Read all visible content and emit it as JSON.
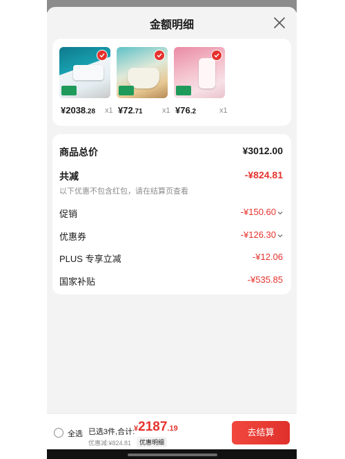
{
  "sheet": {
    "title": "金额明细"
  },
  "products": [
    {
      "price_int": "¥2038",
      "price_dec": ".28",
      "qty": "x1"
    },
    {
      "price_int": "¥72",
      "price_dec": ".71",
      "qty": "x1"
    },
    {
      "price_int": "¥76",
      "price_dec": ".2",
      "qty": "x1"
    }
  ],
  "summary": {
    "goods_total_label": "商品总价",
    "goods_total_value": "¥3012.00",
    "total_reduce_label": "共减",
    "total_reduce_value": "-¥824.81",
    "note": "以下优惠不包含红包，请在结算页查看",
    "items": [
      {
        "label": "促销",
        "value": "-¥150.60"
      },
      {
        "label": "优惠券",
        "value": "-¥126.30"
      },
      {
        "label": "PLUS 专享立减",
        "value": "-¥12.06"
      },
      {
        "label": "国家补贴",
        "value": "-¥535.85"
      }
    ]
  },
  "bottom": {
    "select_all": "全选",
    "count_total": "已选3件,合计:",
    "total_yen": "¥",
    "total_int": "2187",
    "total_dec": ".19",
    "discount_line": "优惠减:¥824.81",
    "detail_link": "优惠明细",
    "checkout": "去结算"
  },
  "colors": {
    "accent": "#e5322d",
    "sheet_bg": "#f3f3f3",
    "muted": "#8c8c8c"
  }
}
